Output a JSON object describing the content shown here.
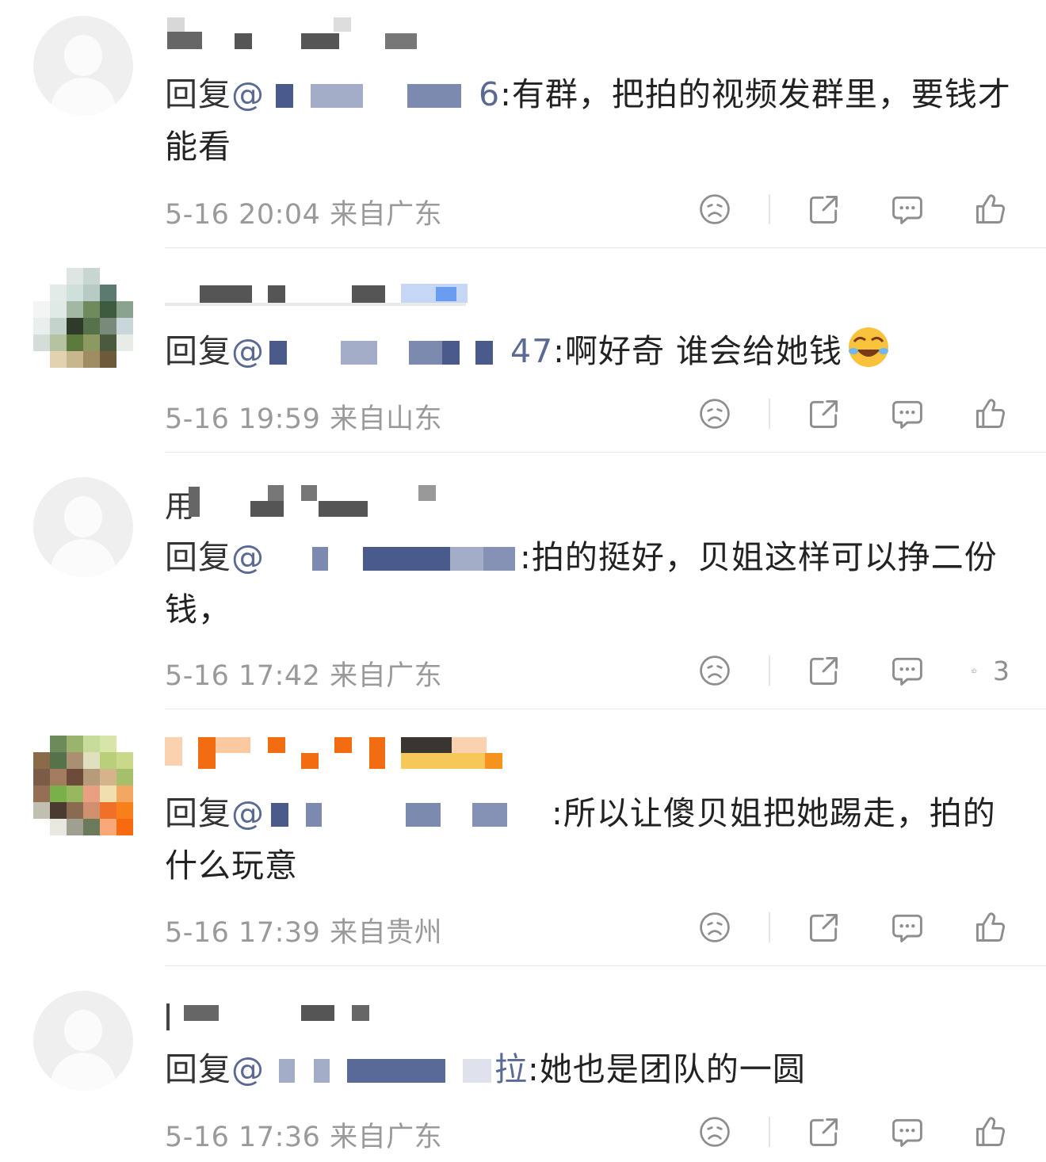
{
  "comments": [
    {
      "reply_prefix": "回复",
      "at": "@",
      "mention_tail": "6",
      "text": ":有群，把拍的视频发群里，要钱才能看",
      "time": "5-16 20:04",
      "location": "来自广东",
      "likes": ""
    },
    {
      "reply_prefix": "回复",
      "at": "@",
      "mention_tail": "47",
      "text": ":啊好奇 谁会给她钱",
      "emoji": "laugh-cry-emoji",
      "time": "5-16 19:59",
      "location": "来自山东",
      "likes": ""
    },
    {
      "name_partial": "用",
      "reply_prefix": "回复",
      "at": "@",
      "mention_tail": "",
      "text": ":拍的挺好，贝姐这样可以挣二份钱，",
      "time": "5-16 17:42",
      "location": "来自广东",
      "likes": "3"
    },
    {
      "reply_prefix": "回复",
      "at": "@",
      "mention_tail": "",
      "text": ":所以让傻贝姐把她踢走，拍的什么玩意",
      "time": "5-16 17:39",
      "location": "来自贵州",
      "likes": ""
    },
    {
      "reply_prefix": "回复",
      "at": "@",
      "mention_tail": "拉",
      "text": ":她也是团队的一圆",
      "time": "5-16 17:36",
      "location": "来自广东",
      "likes": ""
    }
  ],
  "icons": {
    "dislike": "sad-face-icon",
    "share": "share-icon",
    "comment": "comment-icon",
    "like": "thumbs-up-icon"
  },
  "colors": {
    "mention": "#5b6a94",
    "meta": "#9a9a9a",
    "icon": "#8e8e8e"
  }
}
